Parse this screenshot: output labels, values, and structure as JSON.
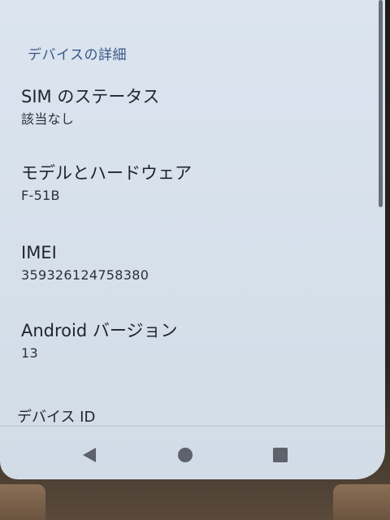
{
  "section": {
    "title": "デバイスの詳細"
  },
  "items": [
    {
      "title": "SIM のステータス",
      "summary": "該当なし"
    },
    {
      "title": "モデルとハードウェア",
      "summary": "F-51B"
    },
    {
      "title": "IMEI",
      "summary": "359326124758380"
    },
    {
      "title": "Android バージョン",
      "summary": "13"
    },
    {
      "title": "デバイス ID",
      "summary": ""
    }
  ],
  "navbar": {
    "back_icon": "back-triangle-icon",
    "home_icon": "home-circle-icon",
    "recents_icon": "recents-square-icon"
  },
  "colors": {
    "screen_bg": "#d8e1ec",
    "header_text": "#3a5686",
    "title_text": "#22252b",
    "nav_icon": "#5d626b"
  }
}
